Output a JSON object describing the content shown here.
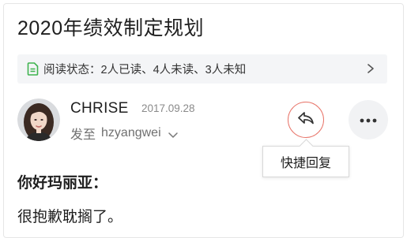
{
  "email": {
    "title": "2020年绩效制定规划",
    "read_status": "阅读状态：2人已读、4人未读、3人未知",
    "sender": {
      "name": "CHRISE",
      "date": "2017.09.28",
      "to_label": "发至",
      "to_value": "hzyangwei"
    },
    "tooltip": "快捷回复",
    "body": {
      "greeting": "你好玛丽亚：",
      "line1": "很抱歉耽搁了。"
    }
  },
  "icons": {
    "read_status": "document-icon",
    "read_status_arrow": "chevron-right-icon",
    "recipients_toggle": "chevron-down-icon",
    "reply": "reply-icon",
    "more": "more-icon"
  },
  "colors": {
    "accent_green": "#3fb34f",
    "reply_ring": "#e8756a",
    "read_bar_bg": "#f4f5f7",
    "more_bg": "#f1f2f4"
  }
}
